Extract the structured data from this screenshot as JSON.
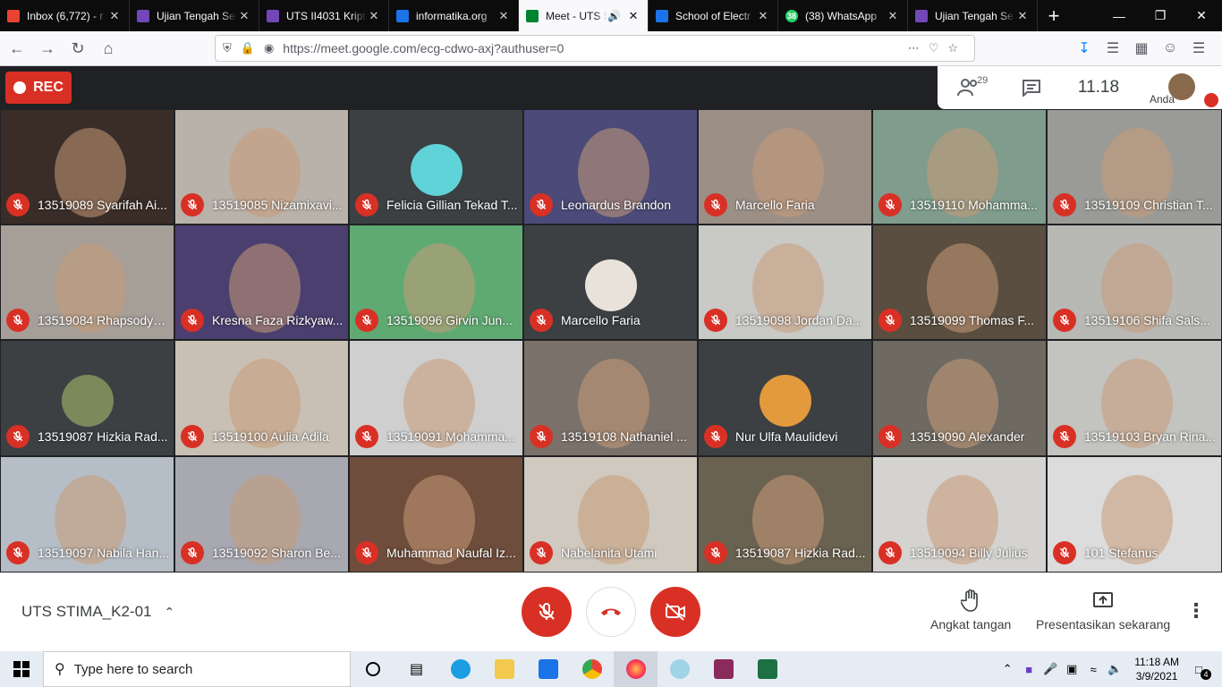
{
  "browser": {
    "tabs": [
      {
        "title": "Inbox (6,772) - r",
        "icon": "gmail-icon",
        "color": "#ea4335",
        "active": false
      },
      {
        "title": "Ujian Tengah Se",
        "icon": "forms-icon",
        "color": "#7248b9",
        "active": false
      },
      {
        "title": "UTS II4031 Kripto",
        "icon": "forms-icon",
        "color": "#7248b9",
        "active": false
      },
      {
        "title": "informatika.org",
        "icon": "page-icon",
        "color": "#1a73e8",
        "active": false
      },
      {
        "title": "Meet - UTS S",
        "icon": "meet-icon",
        "color": "#00832d",
        "active": true
      },
      {
        "title": "School of Electr",
        "icon": "page-icon",
        "color": "#1a73e8",
        "active": false
      },
      {
        "title": "(38) WhatsApp",
        "icon": "whatsapp-icon",
        "color": "#25d366",
        "active": false
      },
      {
        "title": "Ujian Tengah Se",
        "icon": "forms-icon",
        "color": "#7248b9",
        "active": false
      }
    ],
    "whatsapp_badge": "38",
    "url": "https://meet.google.com/ecg-cdwo-axj?authuser=0"
  },
  "meet": {
    "rec_label": "REC",
    "participant_count": "29",
    "clock": "11.18",
    "self_label": "Anda",
    "meeting_name": "UTS STIMA_K2-01",
    "raise_hand_label": "Angkat tangan",
    "present_label": "Presentasikan sekarang",
    "tiles": [
      {
        "name": "13519089 Syarifah Ai...",
        "bg": "#3a2d28",
        "avatar": false
      },
      {
        "name": "13519085 Nizamixavi...",
        "bg": "#b9b2aa",
        "avatar": false
      },
      {
        "name": "Felicia Gillian Tekad T...",
        "bg": "#3c4043",
        "avatar": true,
        "avatar_color": "#5fd3d8"
      },
      {
        "name": "Leonardus Brandon",
        "bg": "#4b4a78",
        "avatar": false
      },
      {
        "name": "Marcello Faria",
        "bg": "#9b8f86",
        "avatar": false
      },
      {
        "name": "13519110 Mohamma...",
        "bg": "#7f9c8c",
        "avatar": false
      },
      {
        "name": "13519109 Christian T...",
        "bg": "#9a9b97",
        "avatar": false
      },
      {
        "name": "13519084 Rhapsodya...",
        "bg": "#a59f98",
        "avatar": false
      },
      {
        "name": "Kresna Faza Rizkyaw...",
        "bg": "#4a3f6e",
        "avatar": false
      },
      {
        "name": "13519096 Girvin Jun...",
        "bg": "#5faa72",
        "avatar": false
      },
      {
        "name": "Marcello Faria",
        "bg": "#3c4043",
        "avatar": true,
        "avatar_color": "#e9e2da"
      },
      {
        "name": "13519098 Jordan Da...",
        "bg": "#c9c9c6",
        "avatar": false
      },
      {
        "name": "13519099 Thomas F...",
        "bg": "#5a4e40",
        "avatar": false
      },
      {
        "name": "13519106 Shifa Sals...",
        "bg": "#b8b8b5",
        "avatar": false
      },
      {
        "name": "13519087 Hizkia Rad...",
        "bg": "#3c4043",
        "avatar": true,
        "avatar_color": "#7b8a5a"
      },
      {
        "name": "13519100 Aulia Adila",
        "bg": "#c8c0b4",
        "avatar": false
      },
      {
        "name": "13519091 Mohamma...",
        "bg": "#cfcfcf",
        "avatar": false
      },
      {
        "name": "13519108 Nathaniel ...",
        "bg": "#7a726a",
        "avatar": false
      },
      {
        "name": "Nur Ulfa Maulidevi",
        "bg": "#3c4043",
        "avatar": true,
        "avatar_color": "#e39a3c"
      },
      {
        "name": "13519090 Alexander",
        "bg": "#6e6a62",
        "avatar": false
      },
      {
        "name": "13519103 Bryan Rina...",
        "bg": "#c3c3c0",
        "avatar": false
      },
      {
        "name": "13519097 Nabila Han...",
        "bg": "#b5bec6",
        "avatar": false
      },
      {
        "name": "13519092 Sharon Be...",
        "bg": "#a7a8b0",
        "avatar": false
      },
      {
        "name": "Muhammad Naufal Iz...",
        "bg": "#6e4d3c",
        "avatar": false
      },
      {
        "name": "Nabelanita Utami",
        "bg": "#cfc9bf",
        "avatar": false
      },
      {
        "name": "13519087 Hizkia Rad...",
        "bg": "#6a6250",
        "avatar": false
      },
      {
        "name": "13519094 Billy Julius",
        "bg": "#d4d3d0",
        "avatar": false
      },
      {
        "name": "101 Stefanus",
        "bg": "#dcdcdc",
        "avatar": false
      }
    ]
  },
  "taskbar": {
    "search_placeholder": "Type here to search",
    "time": "11:18 AM",
    "date": "3/9/2021",
    "notif_count": "4"
  }
}
